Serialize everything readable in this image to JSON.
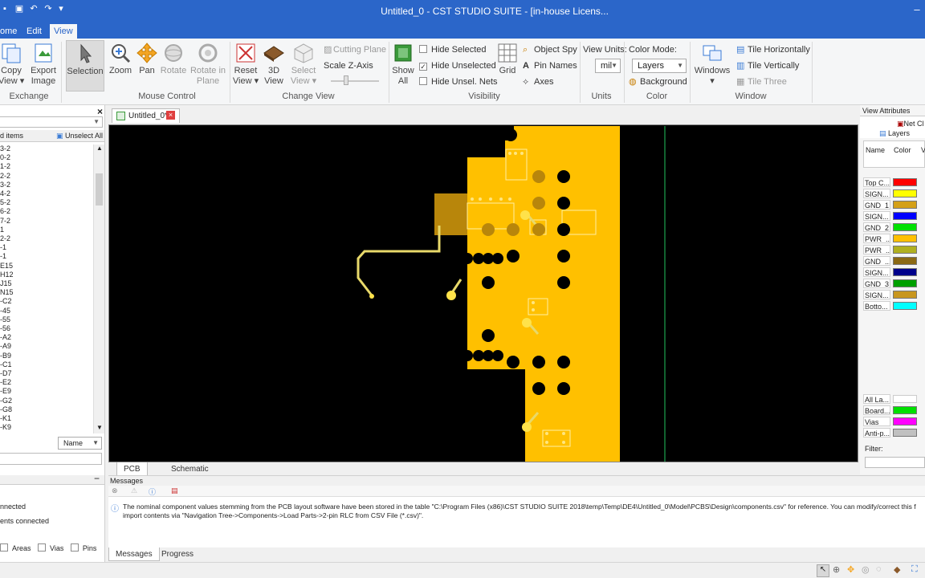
{
  "window": {
    "title": "Untitled_0 - CST STUDIO SUITE - [in-house Licens..."
  },
  "menu": {
    "tabs": [
      "ome",
      "Edit",
      "View"
    ],
    "active": "View"
  },
  "ribbon": {
    "exchange": {
      "copy_view": "Copy\nView ▾",
      "export_image": "Export\nImage",
      "label": "Exchange"
    },
    "mouse_control": {
      "selection": "Selection",
      "zoom": "Zoom",
      "pan": "Pan",
      "rotate": "Rotate",
      "rotate_in_plane": "Rotate in\nPlane",
      "label": "Mouse Control"
    },
    "change_view": {
      "reset_view": "Reset\nView ▾",
      "view_3d": "3D\nView",
      "select_view": "Select\nView ▾",
      "cutting_plane": "Cutting Plane",
      "scale_z_axis": "Scale Z-Axis",
      "label": "Change View"
    },
    "visibility": {
      "show_all": "Show\nAll",
      "hide_selected": "Hide Selected",
      "hide_unselected": "Hide Unselected",
      "hide_unsel_nets": "Hide Unsel. Nets",
      "grid": "Grid",
      "object_spy": "Object Spy",
      "pin_names": "Pin Names",
      "axes": "Axes",
      "label": "Visibility"
    },
    "units": {
      "view_units_label": "View Units:",
      "value": "mil",
      "label": "Units"
    },
    "color": {
      "mode_label": "Color Mode:",
      "mode_value": "Layers",
      "background": "Background",
      "label": "Color"
    },
    "window": {
      "windows": "Windows\n▾",
      "tile_horizontally": "Tile Horizontally",
      "tile_vertically": "Tile Vertically",
      "tile_three": "Tile Three",
      "label": "Window"
    }
  },
  "left_panel": {
    "items_header": "d items",
    "unselect_all": "Unselect All",
    "tree_items": [
      "3-2",
      "0-2",
      "1-2",
      "2-2",
      "3-2",
      "4-2",
      "5-2",
      "6-2",
      "7-2",
      "1",
      "2-2",
      "-1",
      "-1",
      "E15",
      "H12",
      "J15",
      "N15",
      "-C2",
      "-45",
      "-55",
      "-56",
      "-A2",
      "-A9",
      "-B9",
      "-C1",
      "-D7",
      "-E2",
      "-E9",
      "-G2",
      "-G8",
      "-K1",
      "-K9"
    ],
    "sort_value": "Name",
    "info_lines": [
      "nnected",
      "ents connected"
    ],
    "filters": [
      "Areas",
      "Vias",
      "Pins"
    ]
  },
  "document_tab": {
    "label": "Untitled_0*"
  },
  "canvas_tabs": [
    "PCB",
    "Schematic"
  ],
  "view_attributes": {
    "title": "View Attributes",
    "tabs": [
      "Net Cl",
      "Layers"
    ],
    "columns": [
      "Name",
      "Color",
      "V"
    ],
    "layers": [
      {
        "name": "Top C...",
        "color": "#ff0000"
      },
      {
        "name": "SIGN...",
        "color": "#ffff00"
      },
      {
        "name": "GND_1",
        "color": "#d4a017"
      },
      {
        "name": "SIGN...",
        "color": "#0000ff"
      },
      {
        "name": "GND_2",
        "color": "#00e000"
      },
      {
        "name": "PWR_...",
        "color": "#ffc000"
      },
      {
        "name": "PWR_...",
        "color": "#b0b020"
      },
      {
        "name": "GND_...",
        "color": "#8b6914"
      },
      {
        "name": "SIGN...",
        "color": "#00008b"
      },
      {
        "name": "GND_3",
        "color": "#00a000"
      },
      {
        "name": "SIGN...",
        "color": "#c8961e"
      },
      {
        "name": "Botto...",
        "color": "#00ffff"
      }
    ],
    "special": [
      {
        "name": "All La...",
        "color": ""
      },
      {
        "name": "Board...",
        "color": "#00e000"
      },
      {
        "name": "Vias",
        "color": "#ff00ff"
      },
      {
        "name": "Anti-p...",
        "color": "#c0c0c0"
      }
    ],
    "filter_label": "Filter:"
  },
  "messages": {
    "title": "Messages",
    "line1": "The nominal component values stemming from the PCB layout software have been stored in the table \"C:\\Program Files (x86)\\CST STUDIO SUITE 2018\\temp\\Temp\\DE4\\Untitled_0\\Model\\PCBS\\Design\\components.csv\" for reference. You can modify/correct this f",
    "line2": "import contents via \"Navigation Tree->Components->Load Parts->2-pin RLC from CSV File (*.csv)\".",
    "tabs": [
      "Messages",
      "Progress"
    ]
  },
  "colors": {
    "accent": "#2b66c9",
    "board": "#ffc000",
    "canvas": "#000000"
  }
}
